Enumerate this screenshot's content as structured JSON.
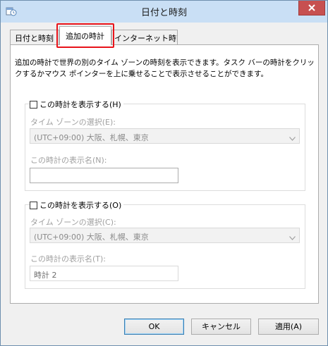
{
  "window": {
    "title": "日付と時刻",
    "icons": {
      "app": "clock-app-icon",
      "close": "close-icon"
    }
  },
  "tabs": [
    {
      "label": "日付と時刻",
      "active": false
    },
    {
      "label": "追加の時計",
      "active": true
    },
    {
      "label": "インターネット時刻",
      "active": false
    }
  ],
  "description": "追加の時計で世界の別のタイム ゾーンの時刻を表示できます。タスク バーの時計をクリックするかマウス ポインターを上に乗せることで表示させることができます。",
  "clock1": {
    "checkbox_label": "この時計を表示する(H)",
    "checked": false,
    "timezone_label": "タイム ゾーンの選択(E):",
    "timezone_value": "(UTC+09:00) 大阪、札幌、東京",
    "name_label": "この時計の表示名(N):",
    "name_value": ""
  },
  "clock2": {
    "checkbox_label": "この時計を表示する(O)",
    "checked": false,
    "timezone_label": "タイム ゾーンの選択(C):",
    "timezone_value": "(UTC+09:00) 大阪、札幌、東京",
    "name_label": "この時計の表示名(T):",
    "name_value": "時計 2"
  },
  "buttons": {
    "ok": "OK",
    "cancel": "キャンセル",
    "apply": "適用(A)"
  },
  "colors": {
    "highlight": "#e8131a",
    "close_button": "#c75050",
    "titlebar": "#c9dff5"
  }
}
